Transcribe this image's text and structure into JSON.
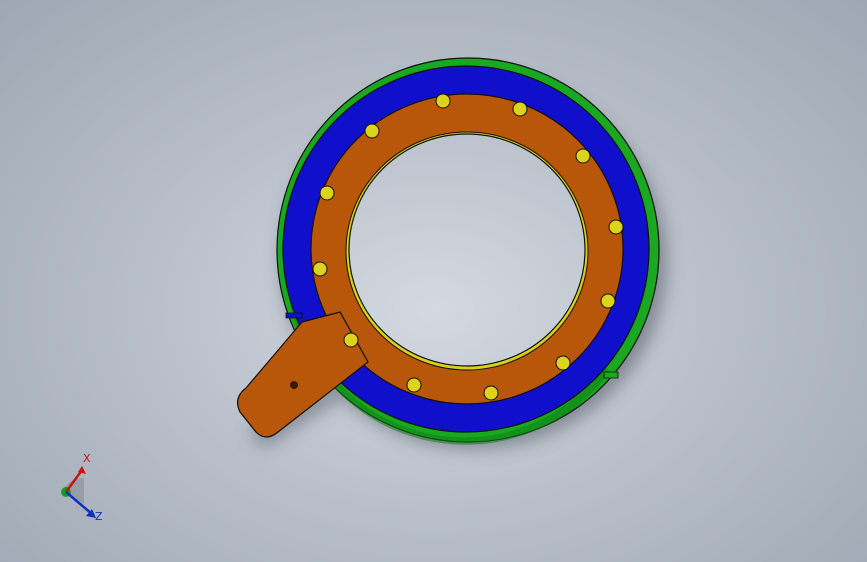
{
  "viewport": {
    "background": "#b9c0ca"
  },
  "model": {
    "colors": {
      "outer_ring": "#19a81f",
      "middle_ring": "#1010cc",
      "inner_ring": "#b8560a",
      "bolt": "#dcd41c",
      "inner_lip": "#d8d21c",
      "edge": "#101010"
    },
    "bolt_count": 13
  },
  "triad": {
    "x_label": "X",
    "z_label": "Z",
    "x_color": "#cc1010",
    "z_color": "#1030c0",
    "y_color": "#10a020"
  }
}
